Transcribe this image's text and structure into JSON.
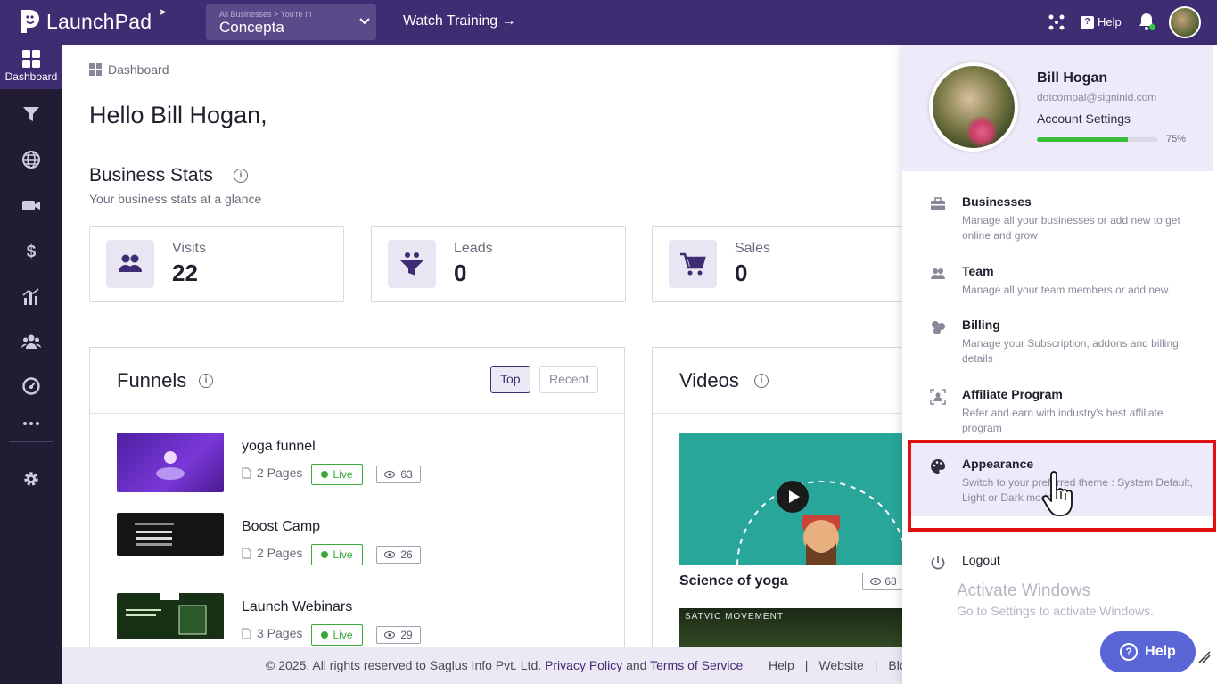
{
  "header": {
    "brand": "LaunchPad",
    "business_crumb": "All Businesses > You're In",
    "business_name": "Concepta",
    "watch_training": "Watch Training →",
    "help_label": "Help"
  },
  "sidebar": {
    "active_label": "Dashboard",
    "items": [
      "funnel-icon",
      "globe-icon",
      "video-icon",
      "dollar-icon",
      "analytics-icon",
      "team-icon",
      "gauge-icon",
      "more-icon",
      "gear-icon"
    ]
  },
  "main": {
    "breadcrumb": "Dashboard",
    "greeting": "Hello Bill Hogan,",
    "stats_title": "Business Stats",
    "stats_subtitle": "Your business stats at a glance",
    "stats": [
      {
        "label": "Visits",
        "value": "22"
      },
      {
        "label": "Leads",
        "value": "0"
      },
      {
        "label": "Sales",
        "value": "0"
      }
    ],
    "funnels": {
      "title": "Funnels",
      "tab_top": "Top",
      "tab_recent": "Recent",
      "rows": [
        {
          "name": "yoga funnel",
          "pages": "2 Pages",
          "status": "Live",
          "views": "63"
        },
        {
          "name": "Boost Camp",
          "pages": "2 Pages",
          "status": "Live",
          "views": "26"
        },
        {
          "name": "Launch Webinars",
          "pages": "3 Pages",
          "status": "Live",
          "views": "29"
        }
      ]
    },
    "videos": {
      "title": "Videos",
      "first_title": "Science of yoga",
      "first_views": "68",
      "second_caption": "SATVIC MOVEMENT"
    }
  },
  "footer": {
    "copyright": "©  2025. All rights reserved to Saglus Info Pvt. Ltd.",
    "privacy": "Privacy Policy",
    "and": "and",
    "terms": "Terms of Service",
    "help": "Help",
    "website": "Website",
    "blog": "Blog",
    "sep": "|"
  },
  "profile_menu": {
    "name": "Bill Hogan",
    "email": "dotcompal@signinid.com",
    "account_settings": "Account Settings",
    "progress_label": "75%",
    "progress_value": 0.75,
    "items": [
      {
        "title": "Businesses",
        "desc": "Manage all your businesses or add new to get online and grow"
      },
      {
        "title": "Team",
        "desc": "Manage all your team members or add new."
      },
      {
        "title": "Billing",
        "desc": "Manage your Subscription, addons and billing details"
      },
      {
        "title": "Affiliate Program",
        "desc": "Refer and earn with industry's best affiliate program"
      },
      {
        "title": "Appearance",
        "desc": "Switch to your preferred theme : System Default, Light or Dark mode."
      }
    ],
    "logout": "Logout"
  },
  "overlay": {
    "activate_title": "Activate Windows",
    "activate_sub": "Go to Settings to activate Windows.",
    "help_button": "Help"
  },
  "colors": {
    "brand": "#3f2d73",
    "sidebar": "#211b34",
    "live": "#3aa93a",
    "highlight": "#e01010",
    "help_fab": "#5a66d6"
  }
}
